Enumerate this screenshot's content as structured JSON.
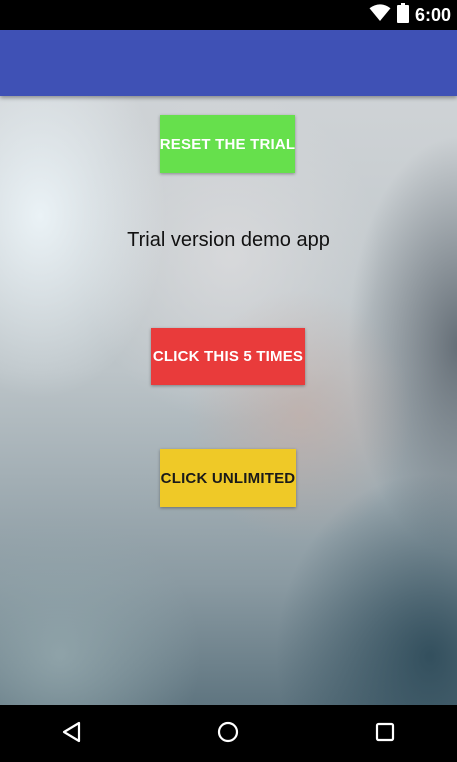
{
  "status_bar": {
    "time": "6:00",
    "icons": [
      "wifi-icon",
      "battery-icon"
    ]
  },
  "app_bar": {
    "color": "#3f51b5"
  },
  "main": {
    "reset_button_label": "RESET THE TRIAL",
    "headline": "Trial version demo app",
    "five_times_button_label": "CLICK THIS 5 TIMES",
    "unlimited_button_label": "CLICK UNLIMITED",
    "colors": {
      "reset_button": "#66e04c",
      "five_times_button": "#e93b3b",
      "unlimited_button": "#efc927"
    }
  },
  "nav_bar": {
    "icons": [
      "back-icon",
      "home-icon",
      "recents-icon"
    ]
  }
}
